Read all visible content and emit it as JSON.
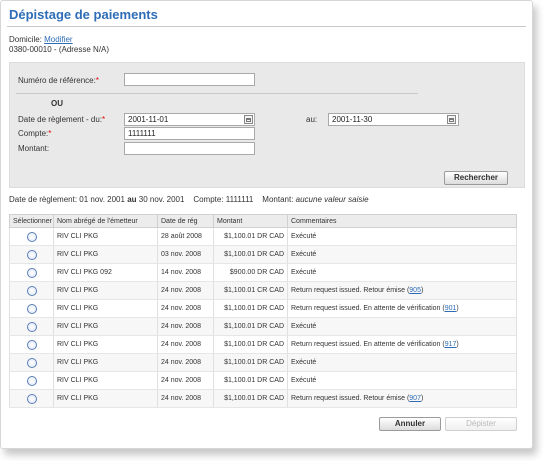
{
  "page": {
    "title": "Dépistage de paiements"
  },
  "domicile": {
    "label": "Domicile:",
    "change_link": "Modifier",
    "account": "0380-00010 -  (Adresse N/A)"
  },
  "form": {
    "reference_label": "Numéro de référence:",
    "reference_value": "",
    "or_label": "OU",
    "date_from_label": "Date de règlement - du:",
    "date_from_value": "2001-11-01",
    "date_to_label": "au:",
    "date_to_value": "2001-11-30",
    "account_label": "Compte:",
    "account_value": "1111111",
    "amount_label": "Montant:",
    "amount_value": "",
    "search_button": "Rechercher"
  },
  "summary": {
    "date_label": "Date de règlement:",
    "date_from": "01 nov. 2001",
    "between": "au",
    "date_to": "30 nov. 2001",
    "account_label": "Compte:",
    "account_value": "1111111",
    "amount_label": "Montant:",
    "amount_value": "aucune valeur saisie"
  },
  "table": {
    "headers": [
      "Sélectionner",
      "Nom abrégé de l'émetteur",
      "Date de rég",
      "Montant",
      "Commentaires"
    ],
    "rows": [
      {
        "issuer": "RIV CLI PKG",
        "date": "28 août 2008",
        "amount": "$1,100.01 DR CAD",
        "comment": "Exécuté",
        "ref": ""
      },
      {
        "issuer": "RIV CLI PKG",
        "date": "03 nov. 2008",
        "amount": "$1,100.01 DR CAD",
        "comment": "Exécuté",
        "ref": ""
      },
      {
        "issuer": "RIV CLI PKG 092",
        "date": "14 nov. 2008",
        "amount": "$900.00 DR CAD",
        "comment": "Exécuté",
        "ref": ""
      },
      {
        "issuer": "RIV CLI PKG",
        "date": "24 nov. 2008",
        "amount": "$1,100.01 CR CAD",
        "comment": "Return request issued. Retour émise (",
        "ref": "905"
      },
      {
        "issuer": "RIV CLI PKG",
        "date": "24 nov. 2008",
        "amount": "$1,100.01 DR CAD",
        "comment": "Return request issued. En attente de vérification (",
        "ref": "901"
      },
      {
        "issuer": "RIV CLI PKG",
        "date": "24 nov. 2008",
        "amount": "$1,100.01 DR CAD",
        "comment": "Exécuté",
        "ref": ""
      },
      {
        "issuer": "RIV CLI PKG",
        "date": "24 nov. 2008",
        "amount": "$1,100.01 DR CAD",
        "comment": "Return request issued. En attente de vérification (",
        "ref": "917"
      },
      {
        "issuer": "RIV CLI PKG",
        "date": "24 nov. 2008",
        "amount": "$1,100.01 DR CAD",
        "comment": "Exécuté",
        "ref": ""
      },
      {
        "issuer": "RIV CLI PKG",
        "date": "24 nov. 2008",
        "amount": "$1,100.01 DR CAD",
        "comment": "Exécuté",
        "ref": ""
      },
      {
        "issuer": "RIV CLI PKG",
        "date": "24 nov. 2008",
        "amount": "$1,100.01 DR CAD",
        "comment": "Return request issued. Retour émise (",
        "ref": "907"
      }
    ]
  },
  "footer": {
    "cancel_button": "Annuler",
    "trace_button": "Dépister"
  }
}
